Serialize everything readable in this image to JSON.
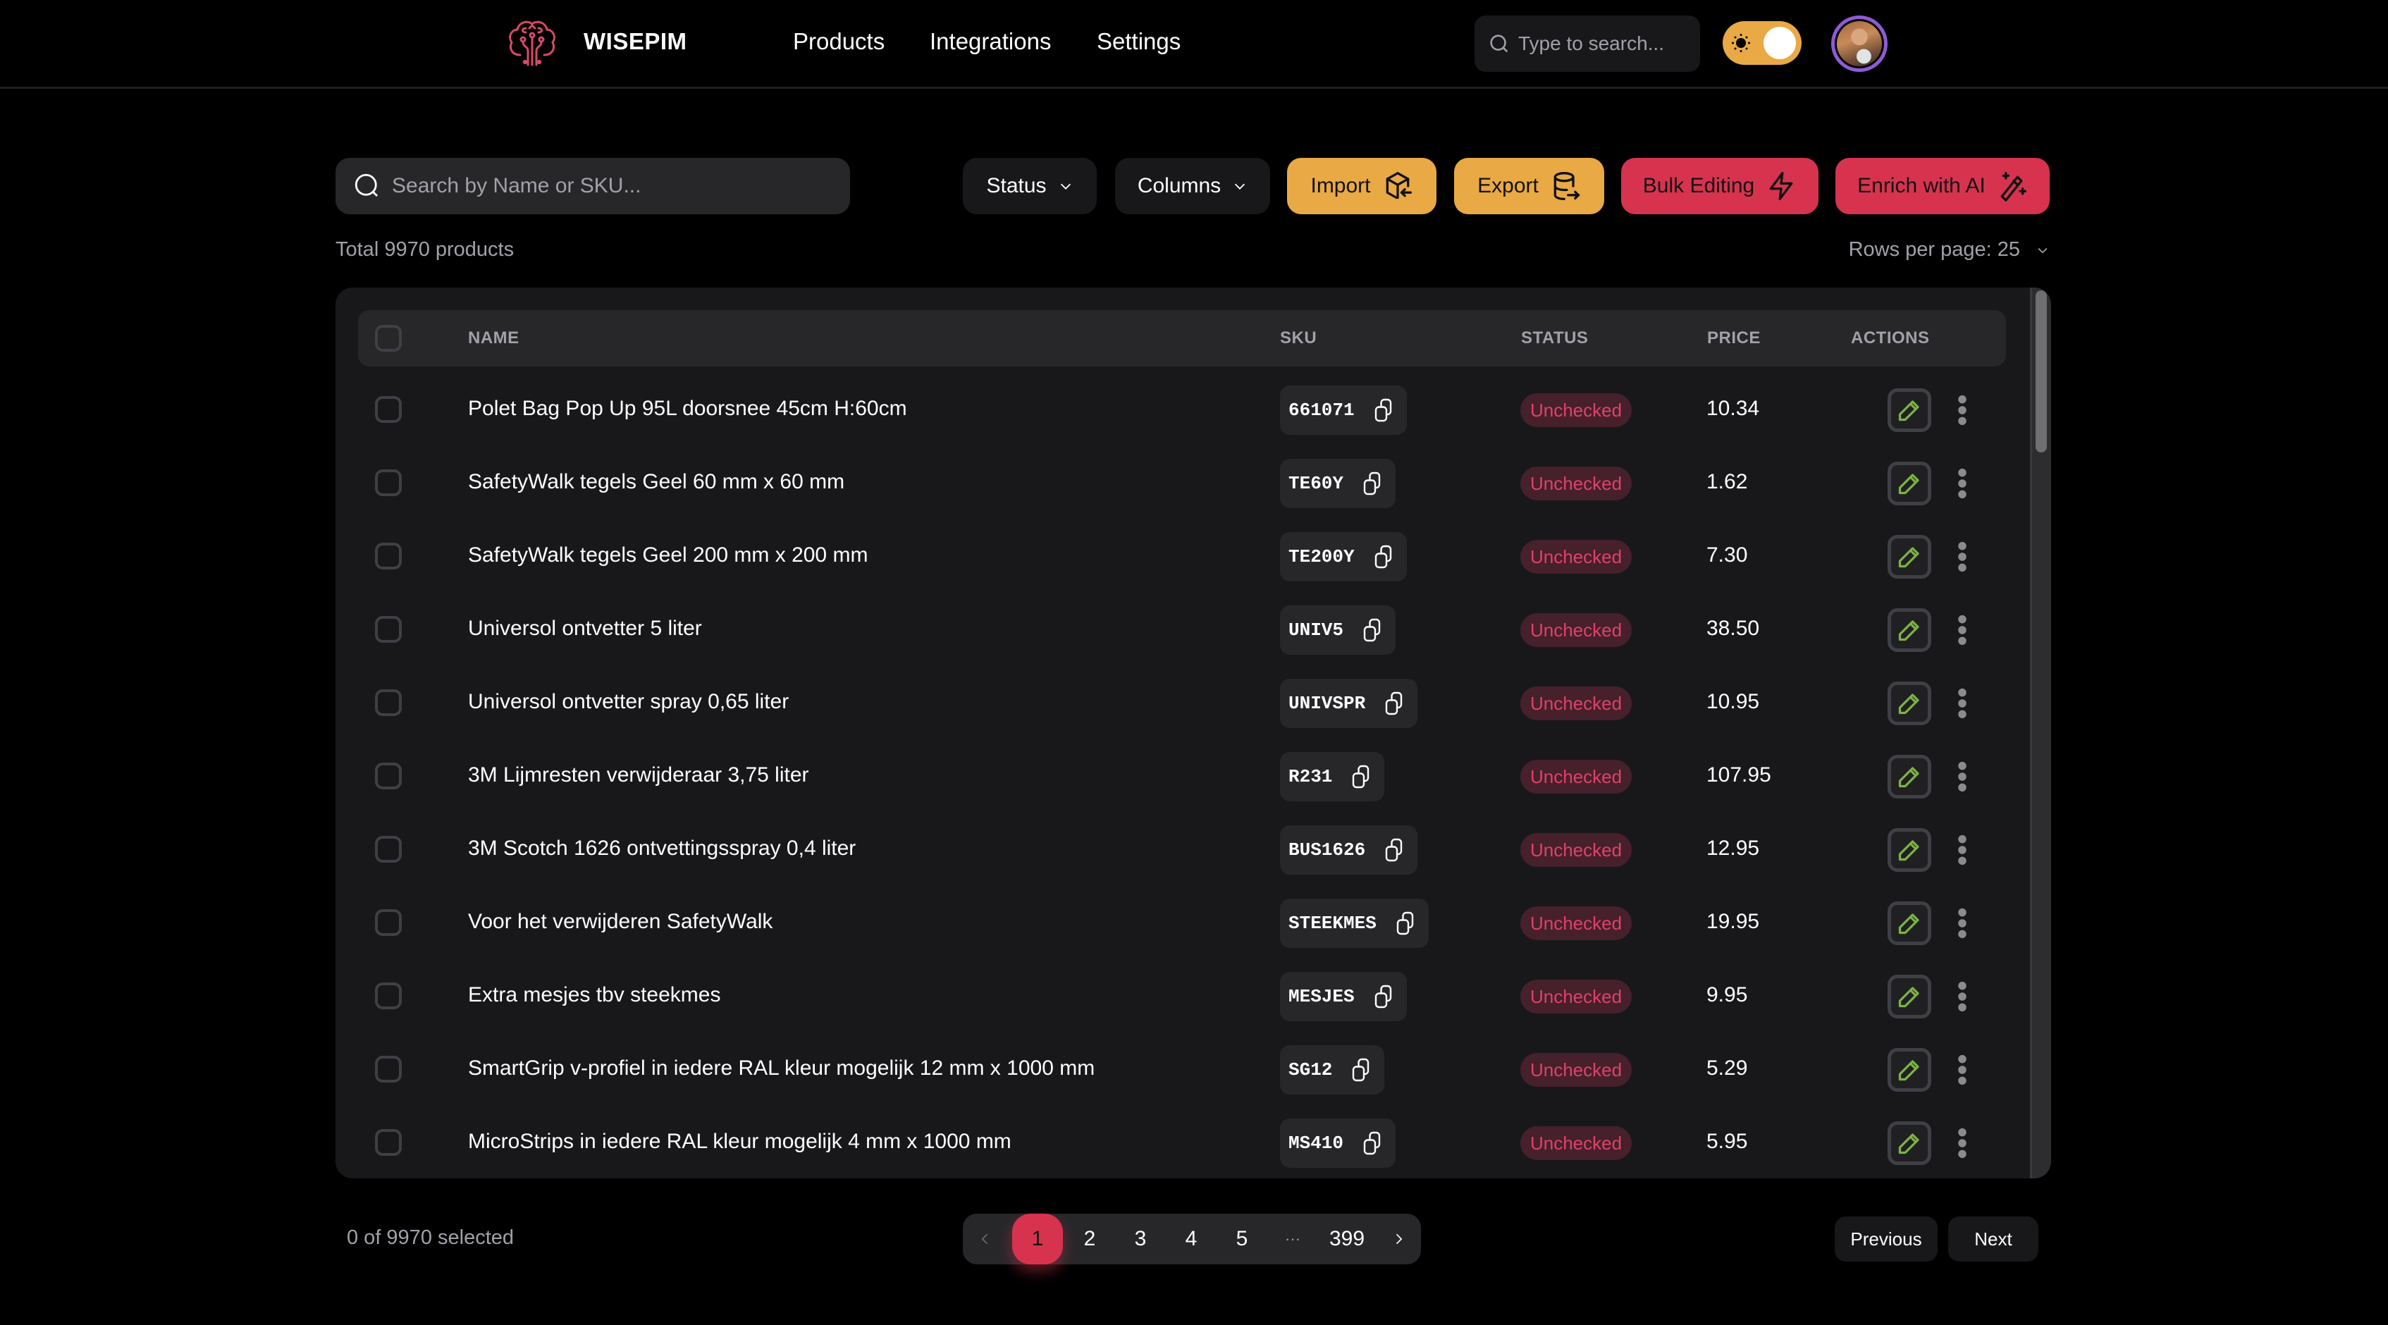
{
  "app": {
    "brand": "WISEPIM",
    "nav": {
      "products": "Products",
      "integrations": "Integrations",
      "settings": "Settings"
    },
    "global_search": {
      "placeholder": "Type to search...",
      "value": ""
    },
    "theme_toggle": {
      "mode": "light",
      "icon": "sun-icon"
    },
    "avatar": {
      "alt": "User avatar"
    }
  },
  "toolbar": {
    "search": {
      "placeholder": "Search by Name or SKU...",
      "value": ""
    },
    "status_label": "Status",
    "columns_label": "Columns",
    "import_label": "Import",
    "export_label": "Export",
    "bulk_label": "Bulk Editing",
    "enrich_label": "Enrich with AI"
  },
  "summary": {
    "total": "Total 9970 products",
    "rows_per_page": "Rows per page: 25"
  },
  "colors": {
    "accent_orange": "#e9a945",
    "accent_red": "#d7334f",
    "status_unchecked_text": "#e0416a",
    "edit_icon": "#7cb342",
    "avatar_ring": "#8f5bd6"
  },
  "table": {
    "headers": {
      "name": "NAME",
      "sku": "SKU",
      "status": "STATUS",
      "price": "PRICE",
      "actions": "ACTIONS"
    },
    "rows": [
      {
        "name": "Polet Bag Pop Up 95L doorsnee 45cm H:60cm",
        "sku": "661071",
        "status": "Unchecked",
        "price": "10.34"
      },
      {
        "name": "SafetyWalk tegels Geel 60 mm x 60 mm",
        "sku": "TE60Y",
        "status": "Unchecked",
        "price": "1.62"
      },
      {
        "name": "SafetyWalk tegels Geel 200 mm x 200 mm",
        "sku": "TE200Y",
        "status": "Unchecked",
        "price": "7.30"
      },
      {
        "name": "Universol ontvetter 5 liter",
        "sku": "UNIV5",
        "status": "Unchecked",
        "price": "38.50"
      },
      {
        "name": "Universol ontvetter spray 0,65 liter",
        "sku": "UNIVSPR",
        "status": "Unchecked",
        "price": "10.95"
      },
      {
        "name": "3M Lijmresten verwijderaar 3,75 liter",
        "sku": "R231",
        "status": "Unchecked",
        "price": "107.95"
      },
      {
        "name": "3M Scotch 1626 ontvettingsspray 0,4 liter",
        "sku": "BUS1626",
        "status": "Unchecked",
        "price": "12.95"
      },
      {
        "name": "Voor het verwijderen SafetyWalk",
        "sku": "STEEKMES",
        "status": "Unchecked",
        "price": "19.95"
      },
      {
        "name": "Extra mesjes tbv steekmes",
        "sku": "MESJES",
        "status": "Unchecked",
        "price": "9.95"
      },
      {
        "name": "SmartGrip v-profiel in iedere RAL kleur mogelijk 12 mm x 1000 mm",
        "sku": "SG12",
        "status": "Unchecked",
        "price": "5.29"
      },
      {
        "name": "MicroStrips in iedere RAL kleur mogelijk 4 mm x 1000 mm",
        "sku": "MS410",
        "status": "Unchecked",
        "price": "5.95"
      }
    ]
  },
  "footer": {
    "selected": "0 of 9970 selected",
    "pages": [
      "1",
      "2",
      "3",
      "4",
      "5"
    ],
    "ellipsis": "···",
    "last_page": "399",
    "current_page": "1",
    "previous_label": "Previous",
    "next_label": "Next"
  }
}
